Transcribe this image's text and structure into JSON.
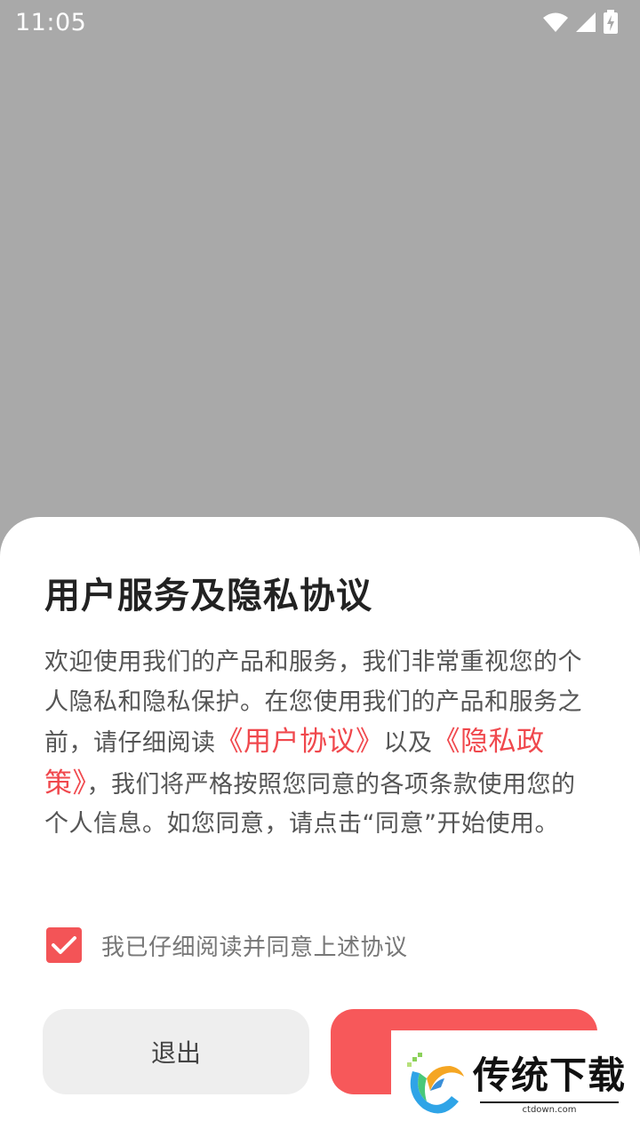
{
  "status_bar": {
    "time": "11:05",
    "icons": [
      "wifi-icon",
      "cell-signal-icon",
      "battery-charging-icon"
    ]
  },
  "dialog": {
    "title": "用户服务及隐私协议",
    "body": {
      "part1": "欢迎使用我们的产品和服务，我们非常重视您的个人隐私和隐私保护。在您使用我们的产品和服务之前，请仔细阅读",
      "link_user_agreement": "《用户协议》",
      "part2": "以及",
      "link_privacy_policy": "《隐私政策》",
      "part3": "，我们将严格按照您同意的各项条款使用您的个人信息。如您同意，请点击“同意”开始使用。"
    },
    "agree_checkbox": {
      "checked": true,
      "label": "我已仔细阅读并同意上述协议"
    },
    "exit_button": "退出",
    "agree_button": ""
  },
  "watermark": {
    "title": "传统下载",
    "url": "ctdown.com"
  },
  "colors": {
    "accent": "#f7585a",
    "link": "#f0484d",
    "scrim": "#a9a9a9",
    "exit_button_bg": "#eeeeee"
  }
}
